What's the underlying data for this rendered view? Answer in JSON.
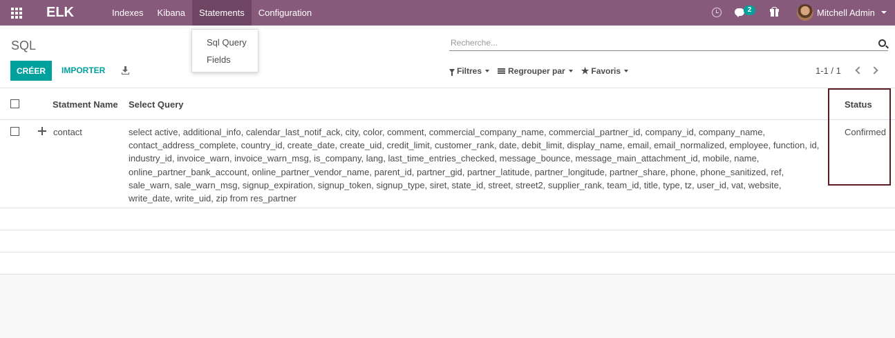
{
  "navbar": {
    "brand": "ELK",
    "menu": [
      "Indexes",
      "Kibana",
      "Statements",
      "Configuration"
    ],
    "active_menu": "Statements",
    "chat_count": "2",
    "user_name": "Mitchell Admin",
    "bg_color": "#875a7b"
  },
  "dropdown": {
    "items": [
      "Sql Query",
      "Fields"
    ]
  },
  "control_panel": {
    "breadcrumb": "SQL",
    "create_label": "CRÉER",
    "import_label": "IMPORTER",
    "search_placeholder": "Recherche...",
    "filters_label": "Filtres",
    "groupby_label": "Regrouper par",
    "favorites_label": "Favoris",
    "pager": "1-1 / 1",
    "accent_color": "#00a09d"
  },
  "table": {
    "headers": {
      "name": "Statment Name",
      "query": "Select Query",
      "status": "Status"
    },
    "rows": [
      {
        "name": "contact",
        "query": "select active, additional_info, calendar_last_notif_ack, city, color, comment, commercial_company_name, commercial_partner_id, company_id, company_name, contact_address_complete, country_id, create_date, create_uid, credit_limit, customer_rank, date, debit_limit, display_name, email, email_normalized, employee, function, id, industry_id, invoice_warn, invoice_warn_msg, is_company, lang, last_time_entries_checked, message_bounce, message_main_attachment_id, mobile, name, online_partner_bank_account, online_partner_vendor_name, parent_id, partner_gid, partner_latitude, partner_longitude, partner_share, phone, phone_sanitized, ref, sale_warn, sale_warn_msg, signup_expiration, signup_token, signup_type, siret, state_id, street, street2, supplier_rank, team_id, title, type, tz, user_id, vat, website, write_date, write_uid, zip from res_partner",
        "status": "Confirmed"
      }
    ]
  }
}
